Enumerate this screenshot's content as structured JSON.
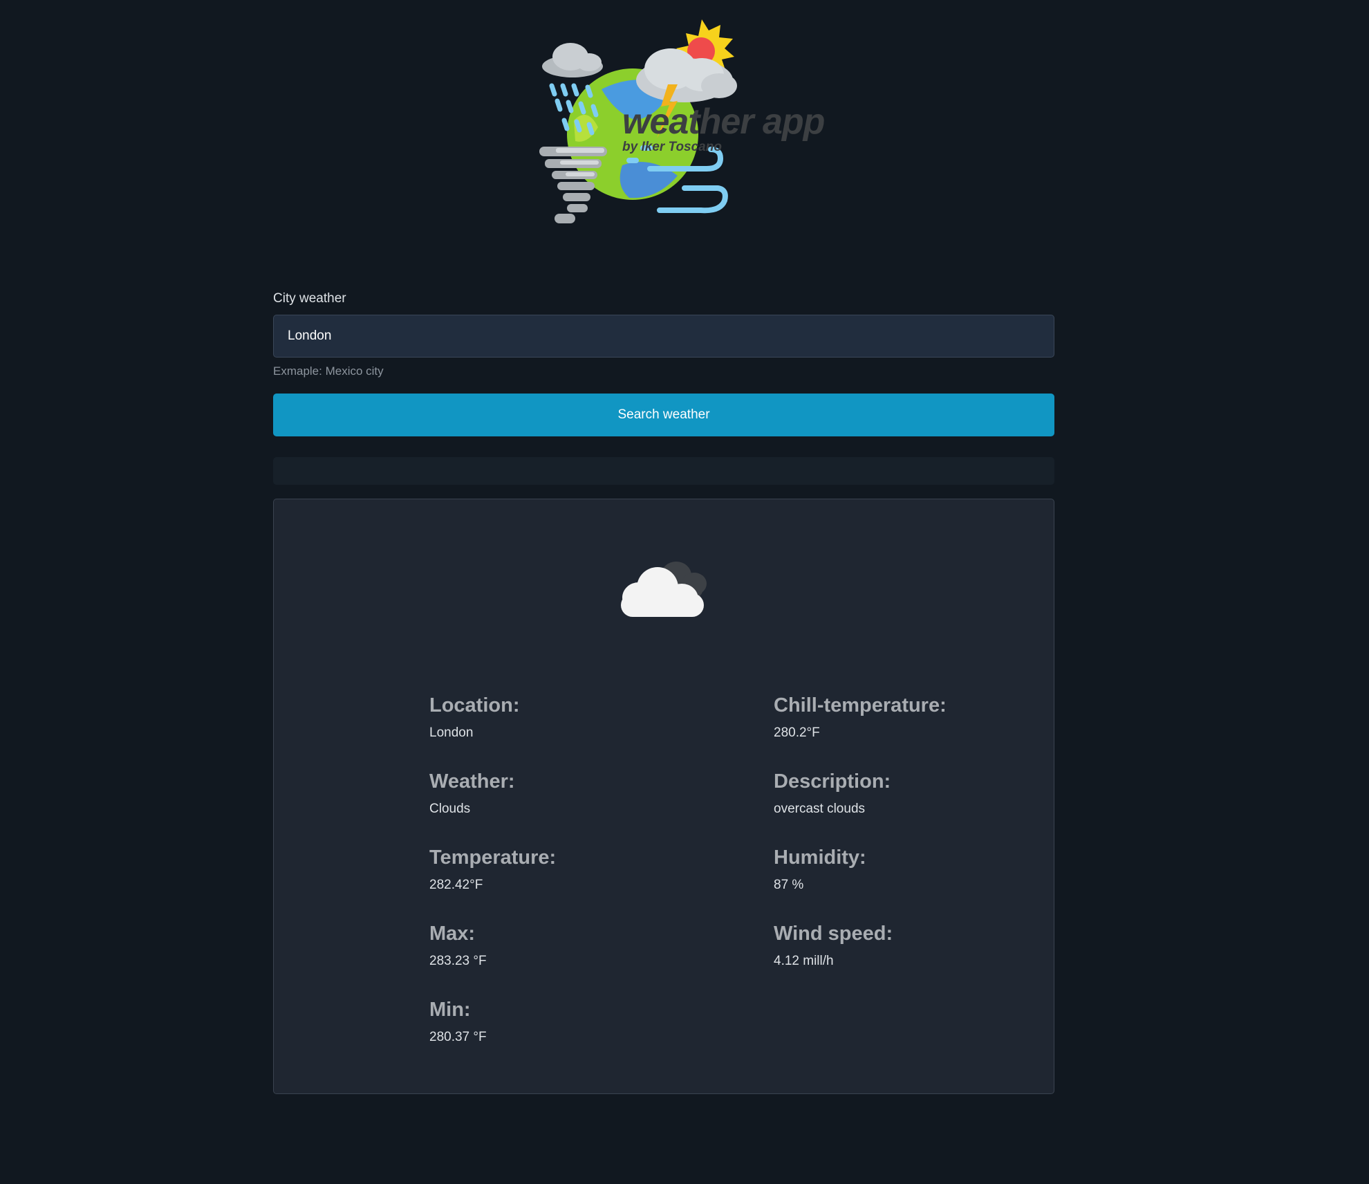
{
  "logo": {
    "title": "weather app",
    "byline": "by Iker Toscano"
  },
  "search": {
    "label": "City weather",
    "value": "London",
    "help": "Exmaple: Mexico city",
    "button_label": "Search weather"
  },
  "result": {
    "icon": "overcast-clouds-icon",
    "left": [
      {
        "label": "Location:",
        "value": "London"
      },
      {
        "label": "Weather:",
        "value": "Clouds"
      },
      {
        "label": "Temperature:",
        "value": "282.42°F"
      },
      {
        "label": "Max:",
        "value": "283.23 °F"
      },
      {
        "label": "Min:",
        "value": "280.37 °F"
      }
    ],
    "right": [
      {
        "label": "Chill-temperature:",
        "value": "280.2°F"
      },
      {
        "label": "Description:",
        "value": "overcast clouds"
      },
      {
        "label": "Humidity:",
        "value": "87 %"
      },
      {
        "label": "Wind speed:",
        "value": "4.12 mill/h"
      }
    ]
  },
  "colors": {
    "background": "#111820",
    "input_bg": "#212d3e",
    "button": "#1196c3",
    "card_bg": "#1f2631"
  }
}
